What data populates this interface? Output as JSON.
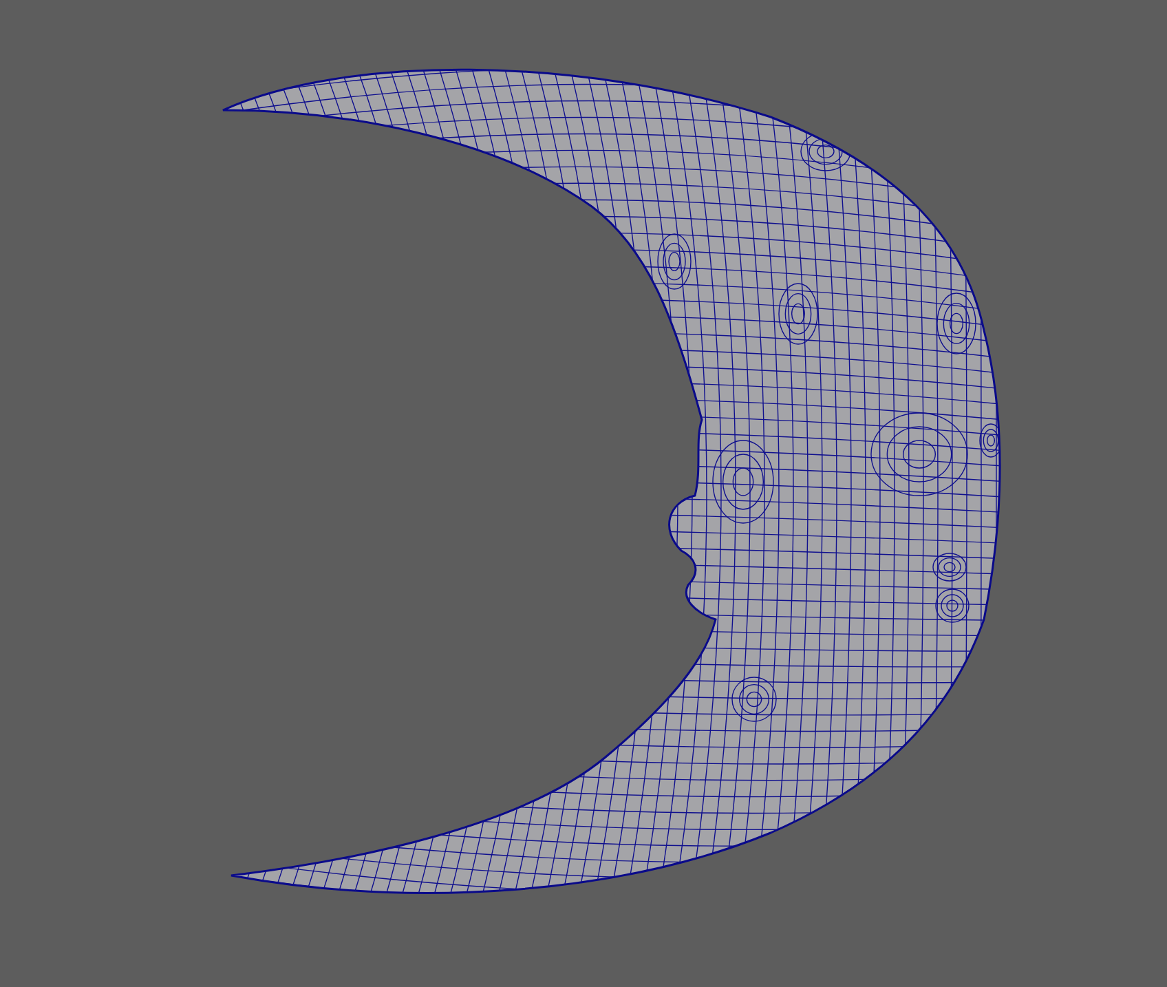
{
  "viewport": {
    "objects": [
      {
        "kind": "mesh"
      }
    ]
  }
}
